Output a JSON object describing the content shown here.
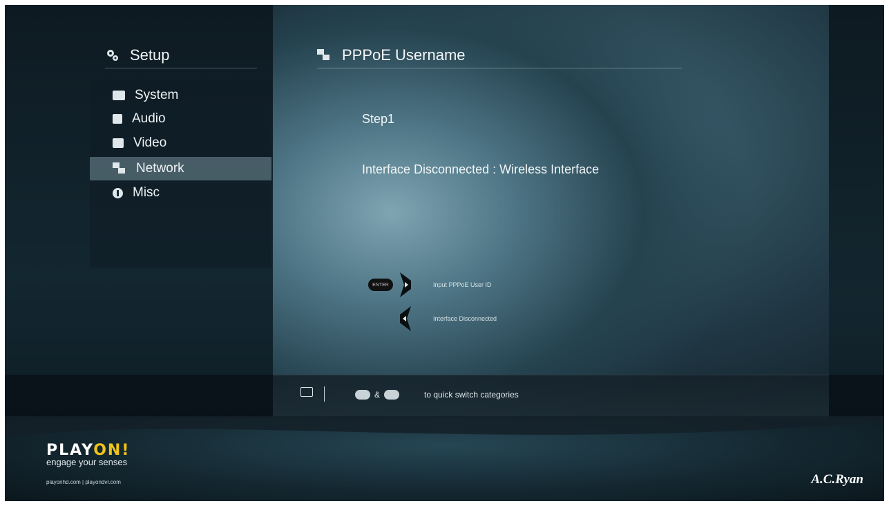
{
  "sidebar": {
    "title": "Setup",
    "items": [
      {
        "label": "System",
        "icon": "system-icon",
        "selected": false
      },
      {
        "label": "Audio",
        "icon": "audio-icon",
        "selected": false
      },
      {
        "label": "Video",
        "icon": "video-icon",
        "selected": false
      },
      {
        "label": "Network",
        "icon": "network-icon",
        "selected": true
      },
      {
        "label": "Misc",
        "icon": "info-icon",
        "selected": false
      }
    ]
  },
  "main": {
    "title": "PPPoE Username",
    "step": "Step1",
    "status": "Interface Disconnected : Wireless Interface",
    "hints": [
      {
        "button": "ENTER",
        "arrow": "right",
        "text": "Input PPPoE User ID"
      },
      {
        "button": "",
        "arrow": "left",
        "text": "Interface Disconnected"
      }
    ]
  },
  "bottom_bar": {
    "separator": "&",
    "hint": "to quick switch categories"
  },
  "footer": {
    "logo_part1": "PLAY",
    "logo_part2": "ON!",
    "tagline": "engage your senses",
    "links": "playonhd.com | playondvr.com",
    "brand": "A.C.Ryan"
  },
  "colors": {
    "accent": "#f0c419",
    "selected_bg": "#6e8f9a"
  }
}
